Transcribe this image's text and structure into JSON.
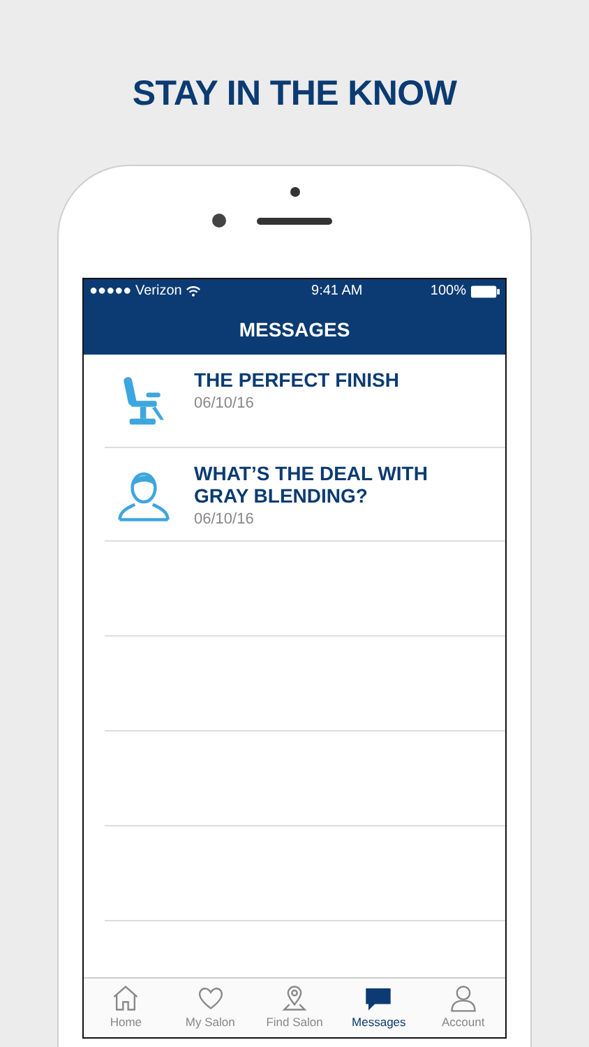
{
  "headline": "STAY IN THE KNOW",
  "status_bar": {
    "carrier": "●●●●● Verizon",
    "time": "9:41 AM",
    "battery": "100%"
  },
  "nav_title": "MESSAGES",
  "messages": [
    {
      "title": "THE PERFECT FINISH",
      "date": "06/10/16"
    },
    {
      "title": "WHAT’S THE DEAL WITH GRAY BLENDING?",
      "date": "06/10/16"
    }
  ],
  "tabs": [
    {
      "label": "Home",
      "selected": false
    },
    {
      "label": "My Salon",
      "selected": false
    },
    {
      "label": "Find Salon",
      "selected": false
    },
    {
      "label": "Messages",
      "selected": true
    },
    {
      "label": "Account",
      "selected": false
    }
  ]
}
